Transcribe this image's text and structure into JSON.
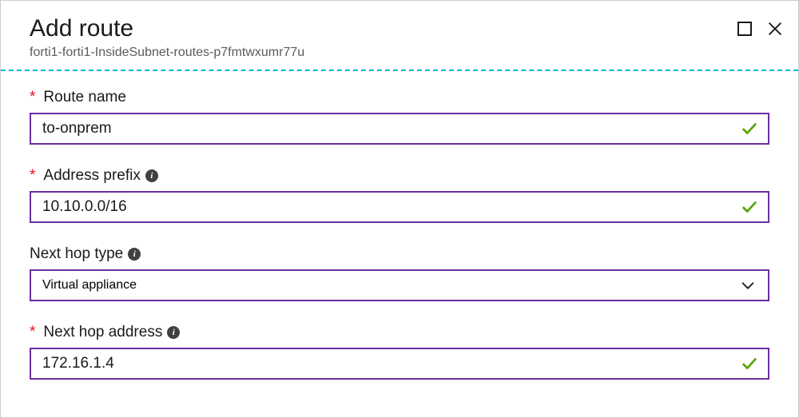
{
  "header": {
    "title": "Add route",
    "subtitle": "forti1-forti1-InsideSubnet-routes-p7fmtwxumr77u"
  },
  "form": {
    "route_name": {
      "label": "Route name",
      "value": "to-onprem",
      "required": true,
      "valid": true
    },
    "address_prefix": {
      "label": "Address prefix",
      "value": "10.10.0.0/16",
      "required": true,
      "valid": true
    },
    "next_hop_type": {
      "label": "Next hop type",
      "value": "Virtual appliance",
      "required": false
    },
    "next_hop_address": {
      "label": "Next hop address",
      "value": "172.16.1.4",
      "required": true,
      "valid": true
    }
  }
}
